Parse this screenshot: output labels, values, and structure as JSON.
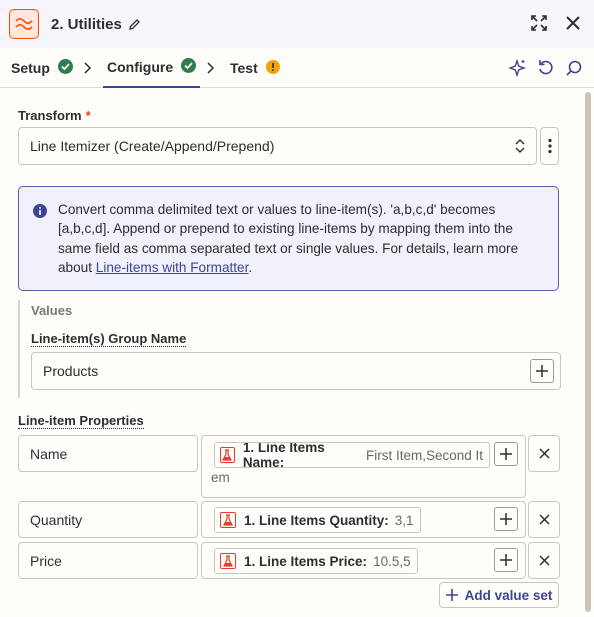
{
  "header": {
    "title": "2. Utilities",
    "icons": [
      "zapier-formatter-icon",
      "pencil-icon",
      "expand-icon",
      "close-icon"
    ]
  },
  "tabs": [
    {
      "label": "Setup",
      "status": "complete"
    },
    {
      "label": "Configure",
      "status": "complete",
      "active": true
    },
    {
      "label": "Test",
      "status": "warning"
    }
  ],
  "tools": [
    "ai-sparkle-icon",
    "undo-icon",
    "search-icon"
  ],
  "transform": {
    "label": "Transform",
    "required_mark": "*",
    "selected": "Line Itemizer (Create/Append/Prepend)"
  },
  "info": {
    "text": "Convert comma delimited text or values to line-item(s). 'a,b,c,d' becomes [a,b,c,d]. Append or prepend to existing line-items by mapping them into the same field as comma separated text or single values. For details, learn more about ",
    "link": "Line-items with Formatter",
    "after": "."
  },
  "values": {
    "title": "Values",
    "group_name_label": "Line-item(s) Group Name",
    "group_name_value": "Products"
  },
  "properties": {
    "label": "Line-item Properties",
    "rows": [
      {
        "key": "Name",
        "pill_label": "1. Line Items Name:",
        "pill_value": "First Item,Second It",
        "wrap": "em"
      },
      {
        "key": "Quantity",
        "pill_label": "1. Line Items Quantity:",
        "pill_value": "3,1"
      },
      {
        "key": "Price",
        "pill_label": "1. Line Items Price:",
        "pill_value": "10.5,5"
      }
    ]
  },
  "add_value_set": "Add value set",
  "colors": {
    "accent": "#3d4592",
    "brand": "#ff4f00",
    "success": "#2f7d4f",
    "warning": "#f2a20c"
  }
}
